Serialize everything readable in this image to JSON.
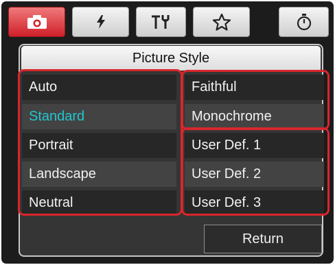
{
  "tabs": [
    {
      "icon": "camera-icon",
      "active": true
    },
    {
      "icon": "flash-icon",
      "active": false
    },
    {
      "icon": "tools-icon",
      "active": false
    },
    {
      "icon": "star-icon",
      "active": false
    },
    {
      "icon": "timer-icon",
      "active": false
    }
  ],
  "panel": {
    "title": "Picture Style",
    "left_options": [
      "Auto",
      "Standard",
      "Portrait",
      "Landscape",
      "Neutral"
    ],
    "right_options": [
      "Faithful",
      "Monochrome",
      "User Def. 1",
      "User Def. 2",
      "User Def. 3"
    ],
    "selected": "Standard",
    "return_label": "Return"
  },
  "colors": {
    "highlight": "#d9262c",
    "selected_text": "#22c6cf",
    "active_tab": "#d0202a"
  }
}
